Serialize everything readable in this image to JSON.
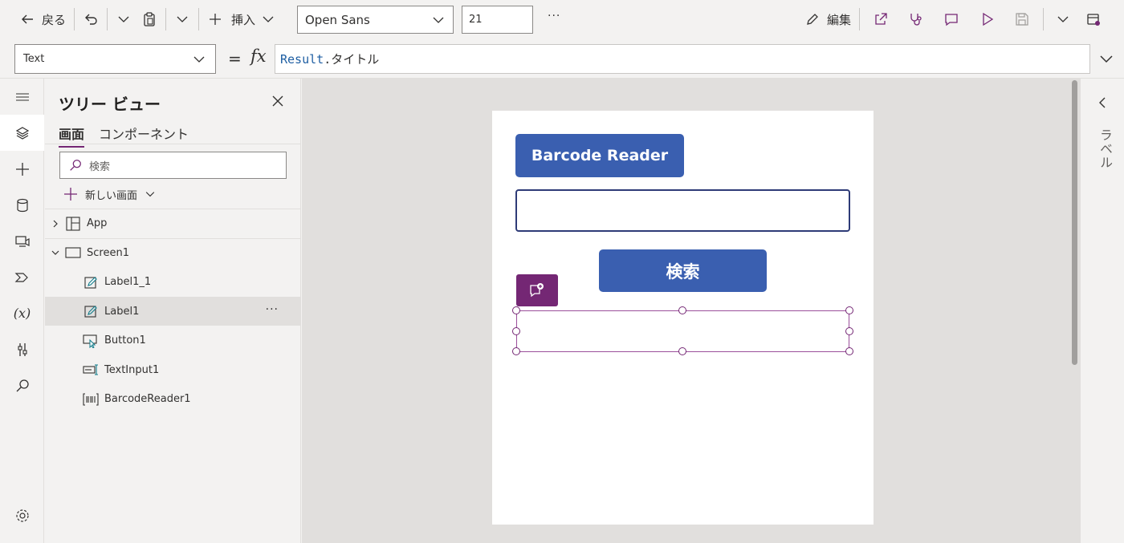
{
  "toolbar": {
    "back_label": "戻る",
    "insert_label": "挿入",
    "font_name": "Open Sans",
    "font_size": "21",
    "more": "···",
    "edit_label": "編集"
  },
  "formula": {
    "property": "Text",
    "equals": "=",
    "fx": "fx",
    "keyword": "Result",
    "rest": ".タイトル"
  },
  "tree": {
    "title": "ツリー ビュー",
    "tabs": [
      "画面",
      "コンポーネント"
    ],
    "search_placeholder": "検索",
    "new_screen": "新しい画面",
    "items": [
      {
        "label": "App",
        "icon": "app-icon"
      },
      {
        "label": "Screen1",
        "icon": "screen-icon"
      },
      {
        "label": "Label1_1",
        "icon": "label-icon"
      },
      {
        "label": "Label1",
        "icon": "label-icon"
      },
      {
        "label": "Button1",
        "icon": "button-icon"
      },
      {
        "label": "TextInput1",
        "icon": "textinput-icon"
      },
      {
        "label": "BarcodeReader1",
        "icon": "barcode-icon"
      }
    ],
    "row_more": "···"
  },
  "canvas": {
    "barcode_button": "Barcode Reader",
    "search_button": "検索"
  },
  "right_panel": {
    "label": "ラベル"
  },
  "colors": {
    "accent": "#742774",
    "button": "#3a5fb0"
  }
}
